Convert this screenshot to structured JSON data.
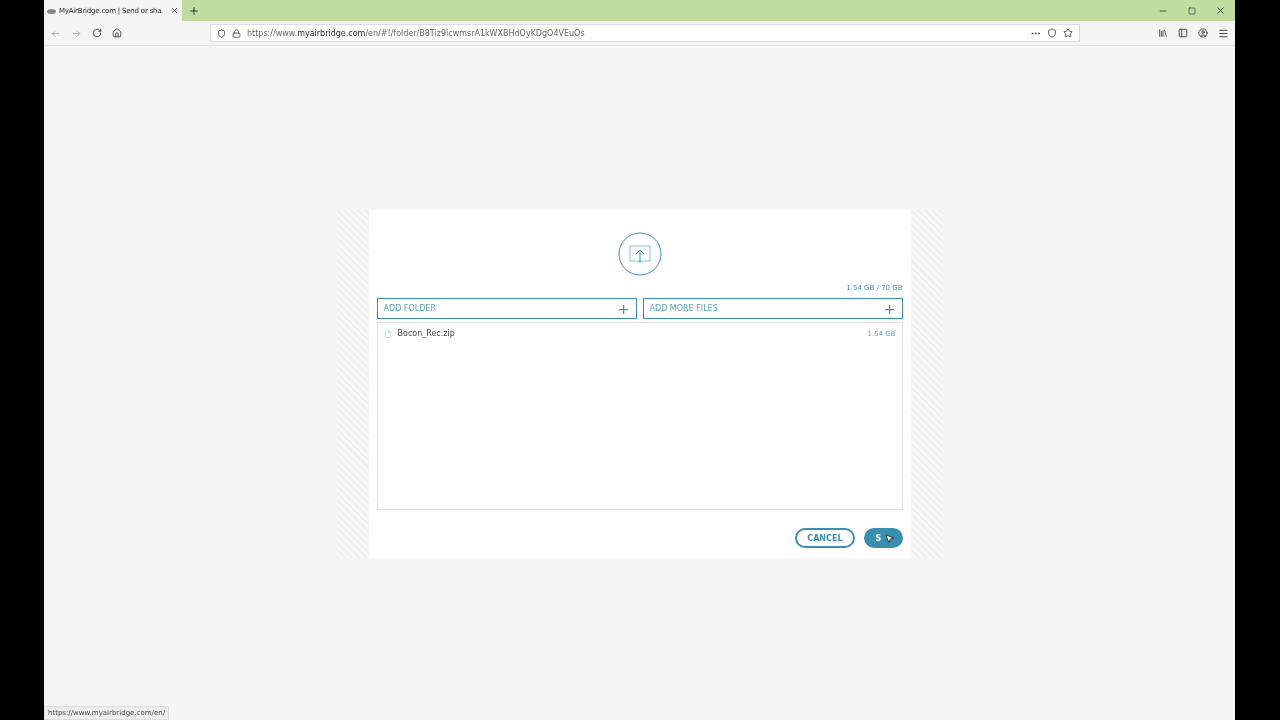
{
  "browser": {
    "tab": {
      "title": "MyAirBridge.com | Send or sha",
      "selected": true
    },
    "url_host": "https://www.",
    "url_domain": "myairbridge.com",
    "url_path": "/en/#!/folder/B8Tiz9icwmsrA1kWXBHdOyKDgO4VEuOs",
    "status_url": "https://www.myairbridge.com/en/"
  },
  "upload": {
    "quota": "1.54 GB / 70 GB",
    "actions": [
      {
        "label": "ADD FOLDER",
        "icon": "+"
      },
      {
        "label": "ADD MORE FILES",
        "icon": "+"
      }
    ],
    "files": [
      {
        "name": "Bocon_Rec.zip",
        "size": "1.54 GB"
      }
    ],
    "buttons": [
      {
        "label": "CANCEL",
        "kind": "outline"
      },
      {
        "label": "S",
        "kind": "primary"
      }
    ]
  }
}
